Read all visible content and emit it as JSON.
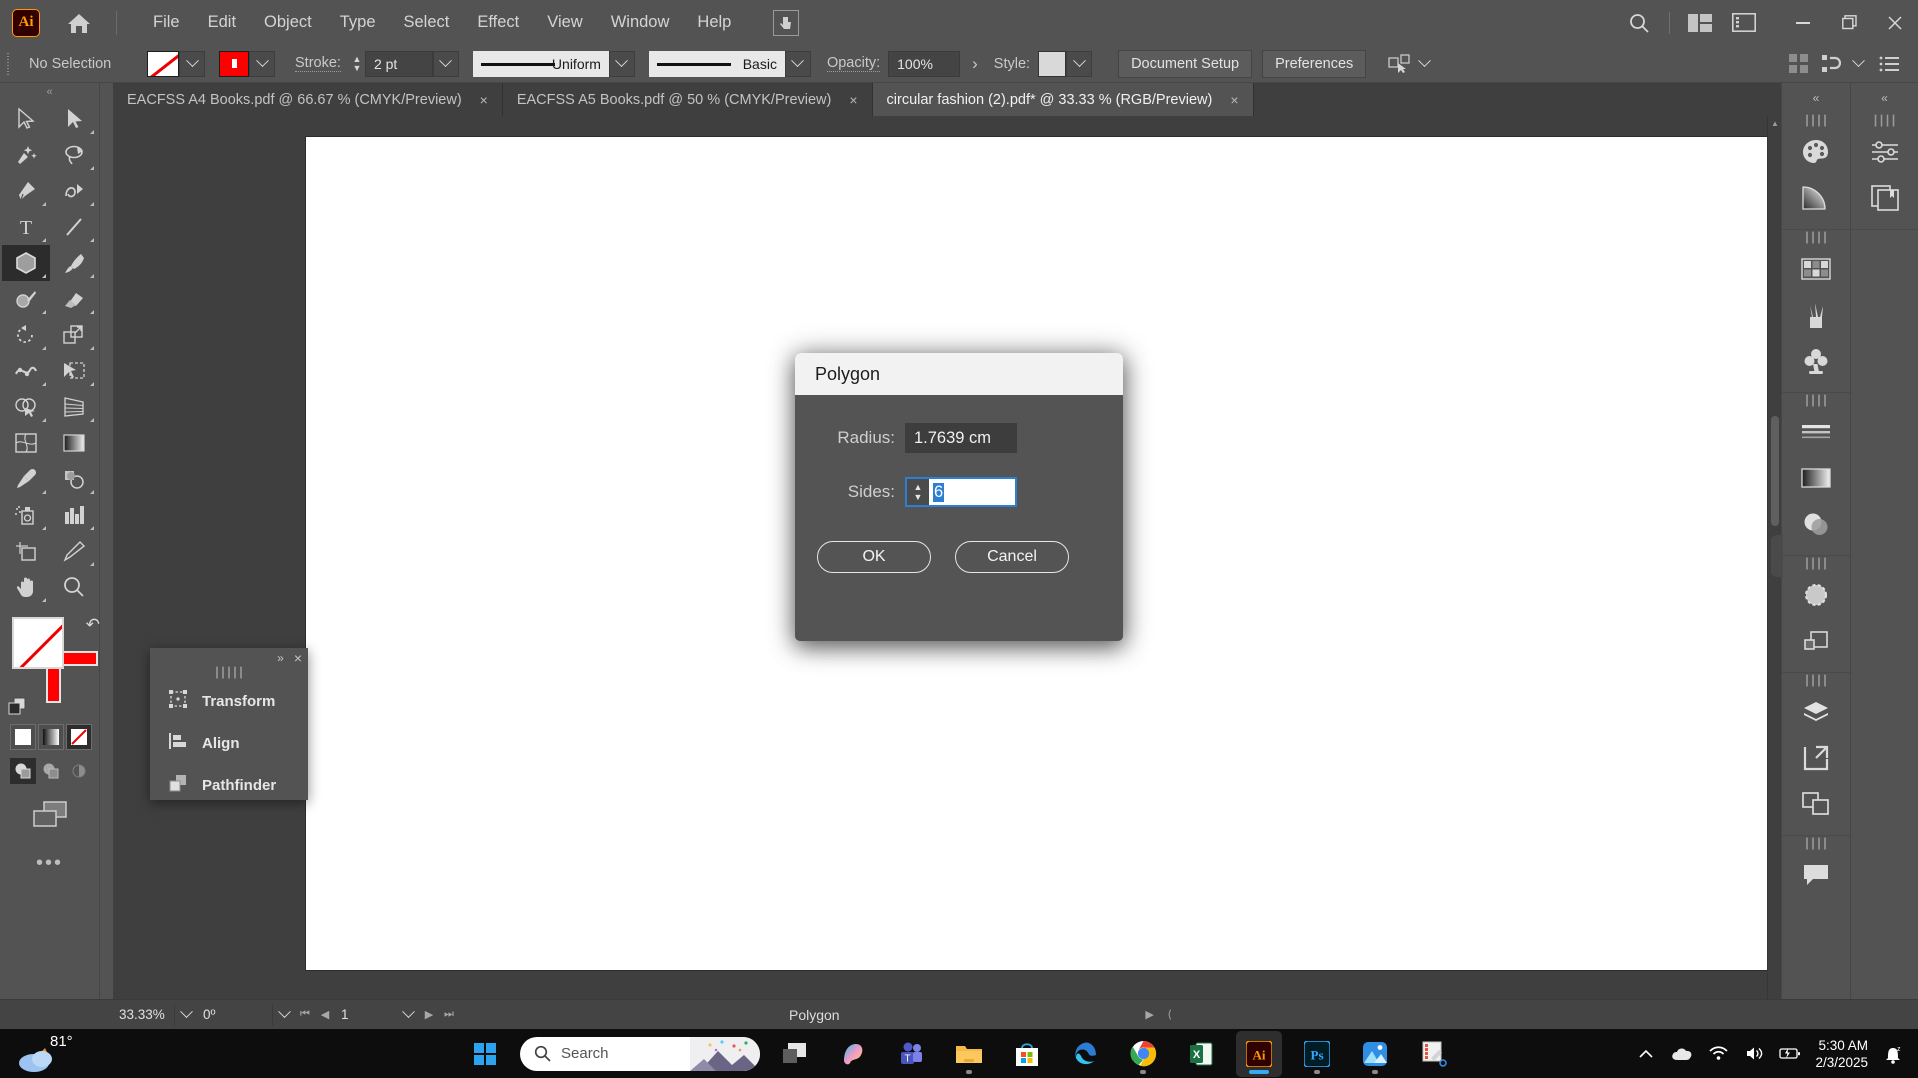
{
  "app": {
    "logo_text": "Ai",
    "menu": [
      "File",
      "Edit",
      "Object",
      "Type",
      "Select",
      "Effect",
      "View",
      "Window",
      "Help"
    ]
  },
  "controlbar": {
    "selection_status": "No Selection",
    "stroke_label": "Stroke:",
    "stroke_weight": "2 pt",
    "profile": "Uniform",
    "brush": "Basic",
    "opacity_label": "Opacity:",
    "opacity_value": "100%",
    "opacity_more": "›",
    "style_label": "Style:",
    "document_setup": "Document Setup",
    "preferences": "Preferences"
  },
  "tabs": [
    {
      "label": "EACFSS  A4 Books.pdf @ 66.67 % (CMYK/Preview)",
      "active": false,
      "close": "×"
    },
    {
      "label": "EACFSS  A5 Books.pdf @ 50 % (CMYK/Preview)",
      "active": false,
      "close": "×"
    },
    {
      "label": "circular fashion (2).pdf* @ 33.33 % (RGB/Preview)",
      "active": true,
      "close": "×"
    }
  ],
  "toolbar": {
    "collapse": "«",
    "tools": [
      "selection-tool",
      "direct-selection-tool",
      "magic-wand-tool",
      "lasso-tool",
      "pen-tool",
      "curvature-tool",
      "type-tool",
      "line-segment-tool",
      "polygon-tool",
      "paintbrush-tool",
      "shaper-tool",
      "eraser-tool",
      "rotate-tool",
      "scale-tool",
      "width-tool",
      "free-transform-tool",
      "shape-builder-tool",
      "perspective-grid-tool",
      "mesh-tool",
      "gradient-tool",
      "eyedropper-tool",
      "blend-tool",
      "symbol-sprayer-tool",
      "column-graph-tool",
      "artboard-tool",
      "slice-tool",
      "hand-tool",
      "zoom-tool"
    ],
    "active_tool": "polygon-tool",
    "more_tools": "•••"
  },
  "float_panel": {
    "collapse": "»",
    "close": "×",
    "items": [
      {
        "label": "Transform",
        "icon": "transform-icon"
      },
      {
        "label": "Align",
        "icon": "align-icon"
      },
      {
        "label": "Pathfinder",
        "icon": "pathfinder-icon"
      }
    ]
  },
  "dialog": {
    "title": "Polygon",
    "radius_label": "Radius:",
    "radius_value": "1.7639 cm",
    "sides_label": "Sides:",
    "sides_value": "6",
    "ok_label": "OK",
    "cancel_label": "Cancel"
  },
  "right_dock": {
    "collapse_left": "«",
    "collapse_right": "«",
    "column_one": [
      [
        "color-panel-icon",
        "gradient-panel-icon"
      ],
      [
        "swatches-panel-icon",
        "brushes-panel-icon",
        "symbols-panel-icon"
      ],
      [
        "stroke-panel-icon",
        "gradient-bar-icon",
        "transparency-panel-icon"
      ],
      [
        "appearance-panel-icon",
        "graphic-styles-panel-icon"
      ],
      [
        "layers-panel-icon",
        "artboards-panel-icon",
        "asset-export-panel-icon"
      ],
      [
        "comments-panel-icon"
      ]
    ],
    "column_two": [
      [
        "properties-panel-icon",
        "libraries-panel-icon"
      ]
    ]
  },
  "statusbar": {
    "zoom": "33.33%",
    "rotation": "0º",
    "page": "1",
    "status_text": "Polygon"
  },
  "taskbar": {
    "weather_temp": "81°",
    "search_placeholder": "Search",
    "apps": [
      "task-view-icon",
      "copilot-icon",
      "teams-icon",
      "file-explorer-icon",
      "microsoft-store-icon",
      "microsoft-edge-icon",
      "google-chrome-icon",
      "microsoft-excel-icon",
      "adobe-illustrator-icon",
      "adobe-photoshop-icon",
      "photos-icon",
      "snipping-tool-icon"
    ],
    "tray": [
      "show-hidden-icons",
      "onedrive-icon",
      "wifi-icon",
      "volume-icon",
      "battery-icon"
    ],
    "time": "5:30 AM",
    "date": "2/3/2025"
  },
  "colors": {
    "app_chrome": "#535353",
    "canvas_bg": "#3f3f3f",
    "accent_blue": "#2f7fd0",
    "stroke_red": "#ff0000",
    "illustrator_orange": "#ff9a00"
  }
}
